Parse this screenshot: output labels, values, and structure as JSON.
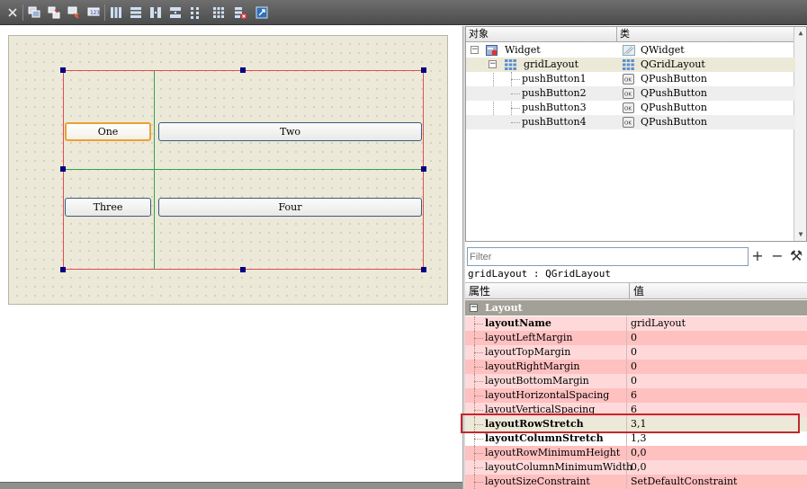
{
  "toolbar": {
    "buttons": [
      "close-icon",
      "edit-widgets-icon",
      "edit-signals-slots-icon",
      "edit-buddies-icon",
      "edit-tab-order-icon",
      "layout-horizontal-icon",
      "layout-vertical-icon",
      "layout-horizontal-splitter-icon",
      "layout-vertical-splitter-icon",
      "layout-form-icon",
      "layout-grid-icon",
      "break-layout-icon",
      "adjust-size-icon"
    ]
  },
  "form": {
    "buttons": [
      {
        "label": "One"
      },
      {
        "label": "Two"
      },
      {
        "label": "Three"
      },
      {
        "label": "Four"
      }
    ]
  },
  "object_inspector": {
    "col_object": "对象",
    "col_class": "类",
    "rows": [
      {
        "name": "Widget",
        "cls": "QWidget"
      },
      {
        "name": "gridLayout",
        "cls": "QGridLayout"
      },
      {
        "name": "pushButton1",
        "cls": "QPushButton"
      },
      {
        "name": "pushButton2",
        "cls": "QPushButton"
      },
      {
        "name": "pushButton3",
        "cls": "QPushButton"
      },
      {
        "name": "pushButton4",
        "cls": "QPushButton"
      }
    ]
  },
  "property_editor": {
    "filter_placeholder": "Filter",
    "add_label": "+",
    "remove_label": "−",
    "tool_label": "⚒",
    "object_label": "gridLayout : QGridLayout",
    "col_property": "属性",
    "col_value": "值",
    "group": "Layout",
    "group_expander": "−",
    "properties": [
      {
        "name": "layoutName",
        "value": "gridLayout"
      },
      {
        "name": "layoutLeftMargin",
        "value": "0"
      },
      {
        "name": "layoutTopMargin",
        "value": "0"
      },
      {
        "name": "layoutRightMargin",
        "value": "0"
      },
      {
        "name": "layoutBottomMargin",
        "value": "0"
      },
      {
        "name": "layoutHorizontalSpacing",
        "value": "6"
      },
      {
        "name": "layoutVerticalSpacing",
        "value": "6"
      },
      {
        "name": "layoutRowStretch",
        "value": "3,1"
      },
      {
        "name": "layoutColumnStretch",
        "value": "1,3"
      },
      {
        "name": "layoutRowMinimumHeight",
        "value": "0,0"
      },
      {
        "name": "layoutColumnMinimumWidth",
        "value": "0,0"
      },
      {
        "name": "layoutSizeConstraint",
        "value": "SetDefaultConstraint"
      }
    ]
  },
  "colors": {
    "property_row_a": "#ffd9d9",
    "property_row_b": "#ffc0c0",
    "highlight_border": "#c0282d",
    "layout_frame": "#e05050",
    "layout_grid_line": "#39a04a",
    "selection_handle": "#000080"
  }
}
